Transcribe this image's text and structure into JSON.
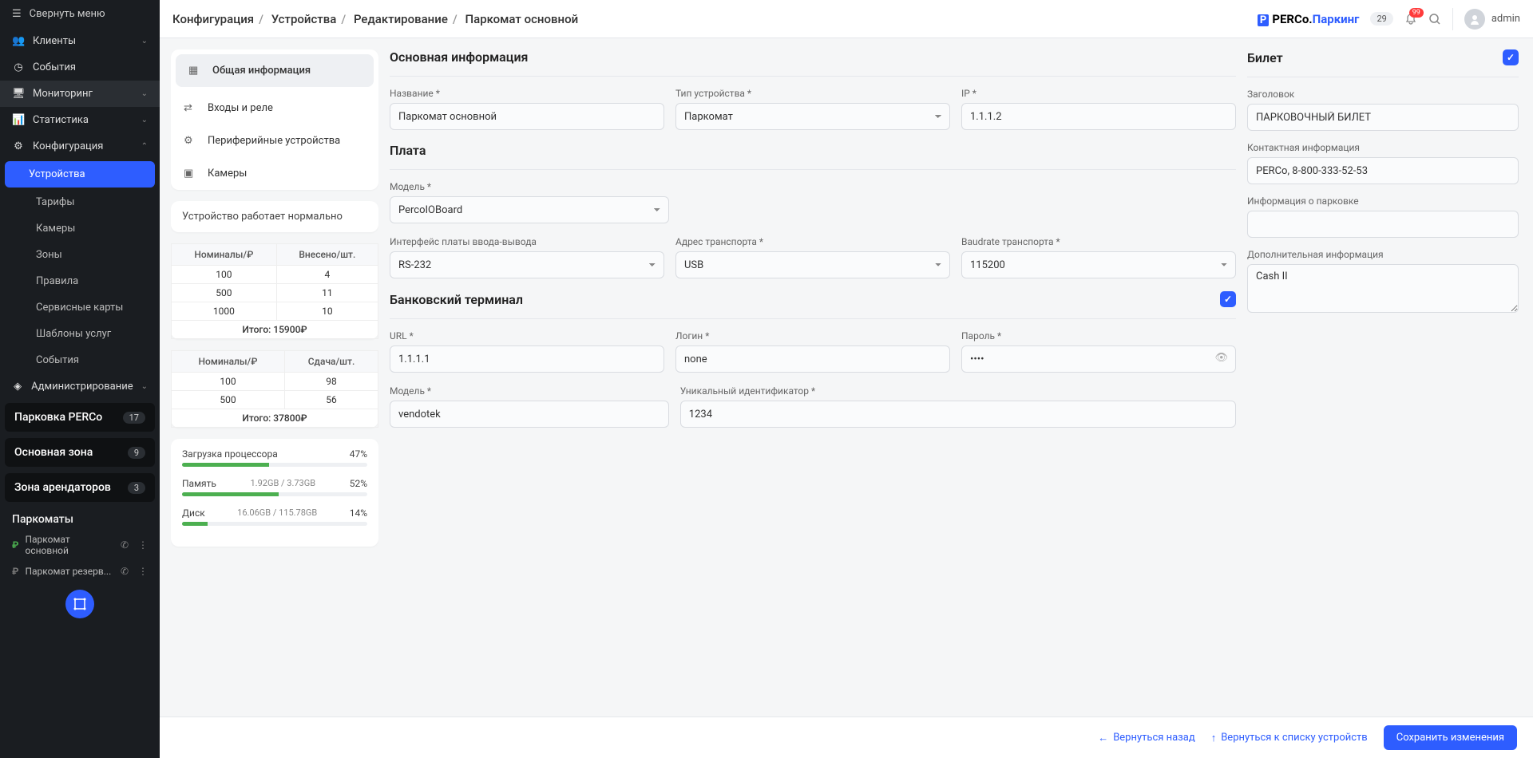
{
  "sidebar": {
    "collapse": "Свернуть меню",
    "nav": [
      {
        "icon": "users",
        "label": "Клиенты",
        "expand": true
      },
      {
        "icon": "clock",
        "label": "События"
      },
      {
        "icon": "monitor",
        "label": "Мониторинг",
        "expand": true,
        "highlight": true
      },
      {
        "icon": "chart",
        "label": "Статистика",
        "expand": true
      },
      {
        "icon": "gear",
        "label": "Конфигурация",
        "expand": true,
        "open": true
      }
    ],
    "config_sub": [
      {
        "label": "Устройства",
        "active": true
      },
      {
        "label": "Тарифы"
      },
      {
        "label": "Камеры"
      },
      {
        "label": "Зоны"
      },
      {
        "label": "Правила"
      },
      {
        "label": "Сервисные карты"
      },
      {
        "label": "Шаблоны услуг"
      },
      {
        "label": "События"
      }
    ],
    "admin": {
      "icon": "admin",
      "label": "Администрирование"
    },
    "groups": [
      {
        "label": "Парковка PERCo",
        "badge": "17"
      },
      {
        "label": "Основная зона",
        "badge": "9"
      },
      {
        "label": "Зона арендаторов",
        "badge": "3"
      }
    ],
    "parkomats_title": "Паркоматы",
    "devices": [
      {
        "label": "Паркомат основной",
        "status": "green"
      },
      {
        "label": "Паркомат резерв...",
        "status": "gray"
      }
    ]
  },
  "breadcrumb": [
    "Конфигурация",
    "Устройства",
    "Редактирование",
    "Паркомат основной"
  ],
  "topbar": {
    "logo_brand": "PERCo.",
    "logo_product": "Паркинг",
    "badge": "29",
    "notifications": "99",
    "user": "admin"
  },
  "tabs": [
    {
      "icon": "doc",
      "label": "Общая информация",
      "active": true
    },
    {
      "icon": "io",
      "label": "Входы и реле"
    },
    {
      "icon": "gear",
      "label": "Периферийные устройства"
    },
    {
      "icon": "camera",
      "label": "Камеры"
    }
  ],
  "status": "Устройство работает нормально",
  "table_in": {
    "headers": [
      "Номиналы/₽",
      "Внесено/шт."
    ],
    "rows": [
      [
        "100",
        "4"
      ],
      [
        "500",
        "11"
      ],
      [
        "1000",
        "10"
      ]
    ],
    "total_label": "Итого:",
    "total": "15900₽"
  },
  "table_out": {
    "headers": [
      "Номиналы/₽",
      "Сдача/шт."
    ],
    "rows": [
      [
        "100",
        "98"
      ],
      [
        "500",
        "56"
      ]
    ],
    "total_label": "Итого:",
    "total": "37800₽"
  },
  "metrics": {
    "cpu": {
      "label": "Загрузка процессора",
      "value": "47%",
      "pct": 47
    },
    "mem": {
      "label": "Память",
      "sub": "1.92GB / 3.73GB",
      "value": "52%",
      "pct": 52
    },
    "disk": {
      "label": "Диск",
      "sub": "16.06GB / 115.78GB",
      "value": "14%",
      "pct": 14
    }
  },
  "form": {
    "section_main": "Основная информация",
    "name_label": "Название *",
    "name": "Паркомат основной",
    "type_label": "Тип устройства *",
    "type": "Паркомат",
    "ip_label": "IP *",
    "ip": "1.1.1.2",
    "section_board": "Плата",
    "model_label": "Модель *",
    "model": "PercoIOBoard",
    "iface_label": "Интерфейс платы ввода-вывода",
    "iface": "RS-232",
    "addr_label": "Адрес транспорта *",
    "addr": "USB",
    "baud_label": "Baudrate транспорта *",
    "baud": "115200",
    "section_term": "Банковский терминал",
    "url_label": "URL *",
    "url": "1.1.1.1",
    "login_label": "Логин *",
    "login": "none",
    "pass_label": "Пароль *",
    "pass": "••••",
    "tmodel_label": "Модель *",
    "tmodel": "vendotek",
    "uid_label": "Уникальный идентификатор *",
    "uid": "1234"
  },
  "ticket": {
    "section": "Билет",
    "title_label": "Заголовок",
    "title": "ПАРКОВОЧНЫЙ БИЛЕТ",
    "contact_label": "Контактная информация",
    "contact": "PERCo, 8-800-333-52-53",
    "parking_label": "Информация о парковке",
    "parking": "",
    "extra_label": "Дополнительная информация",
    "extra": "Cash II"
  },
  "footer": {
    "back": "Вернуться назад",
    "list": "Вернуться к списку устройств",
    "save": "Сохранить изменения"
  }
}
